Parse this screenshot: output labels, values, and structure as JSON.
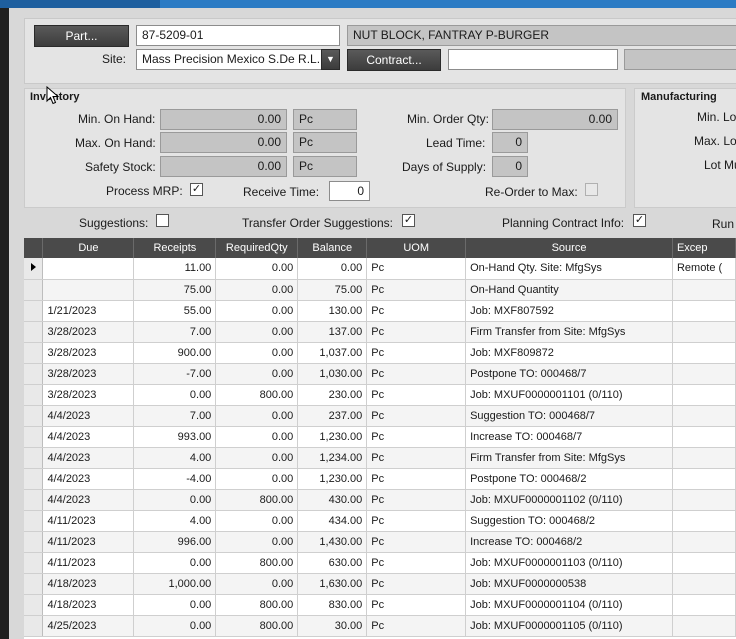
{
  "header": {
    "part_button": "Part...",
    "part_value": "87-5209-01",
    "part_description": "NUT BLOCK, FANTRAY P-BURGER",
    "site_label": "Site:",
    "site_value": "Mass Precision Mexico S.De R.L. D",
    "contract_button": "Contract...",
    "contract_value": ""
  },
  "inventory": {
    "title": "Inventory",
    "min_on_hand_label": "Min. On Hand:",
    "min_on_hand": "0.00",
    "min_on_hand_uom": "Pc",
    "max_on_hand_label": "Max. On Hand:",
    "max_on_hand": "0.00",
    "max_on_hand_uom": "Pc",
    "safety_stock_label": "Safety Stock:",
    "safety_stock": "0.00",
    "safety_stock_uom": "Pc",
    "min_order_qty_label": "Min. Order Qty:",
    "min_order_qty": "0.00",
    "lead_time_label": "Lead Time:",
    "lead_time": "0",
    "days_of_supply_label": "Days of Supply:",
    "days_of_supply": "0",
    "process_mrp_label": "Process MRP:",
    "process_mrp_checked": true,
    "receive_time_label": "Receive Time:",
    "receive_time": "0",
    "reorder_to_max_label": "Re-Order to Max:",
    "reorder_to_max_checked": false
  },
  "manufacturing": {
    "title": "Manufacturing",
    "min_lot_label": "Min. Lo",
    "max_lot_label": "Max. Lo",
    "lot_mult_label": "Lot Mu"
  },
  "options": {
    "suggestions_label": "Suggestions:",
    "suggestions_checked": false,
    "transfer_label": "Transfer Order Suggestions:",
    "transfer_checked": true,
    "planning_label": "Planning Contract Info:",
    "planning_checked": true,
    "run_label": "Run"
  },
  "grid": {
    "columns": [
      "Due",
      "Receipts",
      "RequiredQty",
      "Balance",
      "UOM",
      "Source",
      "Excep"
    ],
    "rows": [
      {
        "due": "",
        "receipts": "11.00",
        "required": "0.00",
        "balance": "0.00",
        "uom": "Pc",
        "source": "On-Hand Qty. Site: MfgSys",
        "exception": "Remote ("
      },
      {
        "due": "",
        "receipts": "75.00",
        "required": "0.00",
        "balance": "75.00",
        "uom": "Pc",
        "source": "On-Hand Quantity",
        "exception": ""
      },
      {
        "due": "1/21/2023",
        "receipts": "55.00",
        "required": "0.00",
        "balance": "130.00",
        "uom": "Pc",
        "source": "Job: MXF807592",
        "exception": ""
      },
      {
        "due": "3/28/2023",
        "receipts": "7.00",
        "required": "0.00",
        "balance": "137.00",
        "uom": "Pc",
        "source": "Firm Transfer from Site: MfgSys",
        "exception": ""
      },
      {
        "due": "3/28/2023",
        "receipts": "900.00",
        "required": "0.00",
        "balance": "1,037.00",
        "uom": "Pc",
        "source": "Job: MXF809872",
        "exception": ""
      },
      {
        "due": "3/28/2023",
        "receipts": "-7.00",
        "required": "0.00",
        "balance": "1,030.00",
        "uom": "Pc",
        "source": "Postpone TO: 000468/7",
        "exception": ""
      },
      {
        "due": "3/28/2023",
        "receipts": "0.00",
        "required": "800.00",
        "balance": "230.00",
        "uom": "Pc",
        "source": "Job: MXUF0000001101 (0/110)",
        "exception": ""
      },
      {
        "due": "4/4/2023",
        "receipts": "7.00",
        "required": "0.00",
        "balance": "237.00",
        "uom": "Pc",
        "source": "Suggestion TO: 000468/7",
        "exception": ""
      },
      {
        "due": "4/4/2023",
        "receipts": "993.00",
        "required": "0.00",
        "balance": "1,230.00",
        "uom": "Pc",
        "source": "Increase TO: 000468/7",
        "exception": ""
      },
      {
        "due": "4/4/2023",
        "receipts": "4.00",
        "required": "0.00",
        "balance": "1,234.00",
        "uom": "Pc",
        "source": "Firm Transfer from Site: MfgSys",
        "exception": ""
      },
      {
        "due": "4/4/2023",
        "receipts": "-4.00",
        "required": "0.00",
        "balance": "1,230.00",
        "uom": "Pc",
        "source": "Postpone TO: 000468/2",
        "exception": ""
      },
      {
        "due": "4/4/2023",
        "receipts": "0.00",
        "required": "800.00",
        "balance": "430.00",
        "uom": "Pc",
        "source": "Job: MXUF0000001102 (0/110)",
        "exception": ""
      },
      {
        "due": "4/11/2023",
        "receipts": "4.00",
        "required": "0.00",
        "balance": "434.00",
        "uom": "Pc",
        "source": "Suggestion TO: 000468/2",
        "exception": ""
      },
      {
        "due": "4/11/2023",
        "receipts": "996.00",
        "required": "0.00",
        "balance": "1,430.00",
        "uom": "Pc",
        "source": "Increase TO: 000468/2",
        "exception": ""
      },
      {
        "due": "4/11/2023",
        "receipts": "0.00",
        "required": "800.00",
        "balance": "630.00",
        "uom": "Pc",
        "source": "Job: MXUF0000001103 (0/110)",
        "exception": ""
      },
      {
        "due": "4/18/2023",
        "receipts": "1,000.00",
        "required": "0.00",
        "balance": "1,630.00",
        "uom": "Pc",
        "source": "Job: MXUF0000000538",
        "exception": ""
      },
      {
        "due": "4/18/2023",
        "receipts": "0.00",
        "required": "800.00",
        "balance": "830.00",
        "uom": "Pc",
        "source": "Job: MXUF0000001104 (0/110)",
        "exception": ""
      },
      {
        "due": "4/25/2023",
        "receipts": "0.00",
        "required": "800.00",
        "balance": "30.00",
        "uom": "Pc",
        "source": "Job: MXUF0000001105 (0/110)",
        "exception": ""
      }
    ]
  }
}
